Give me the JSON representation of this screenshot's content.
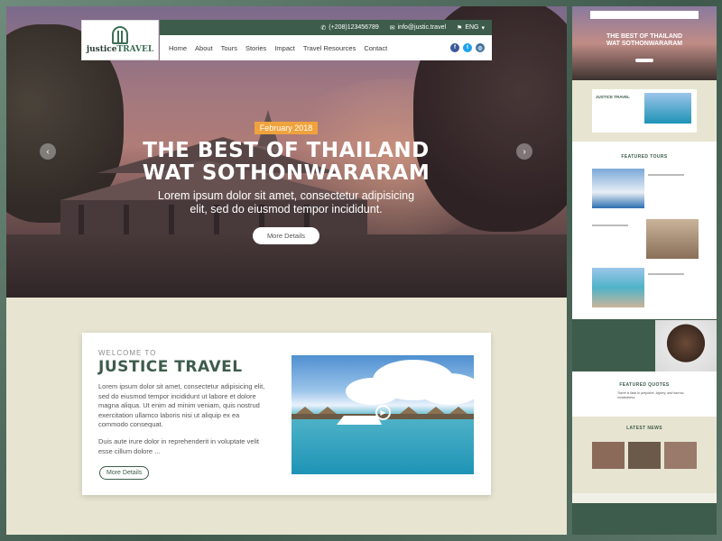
{
  "topbar": {
    "phone": "(+208)123456789",
    "email": "info@justic.travel",
    "language": "ENG"
  },
  "logo": {
    "word1": "justice",
    "word2": "TRAVEL"
  },
  "nav": {
    "items": [
      "Home",
      "About",
      "Tours",
      "Stories",
      "Impact",
      "Travel Resources",
      "Contact"
    ]
  },
  "socials": [
    {
      "icon": "facebook-icon",
      "glyph": "f",
      "color": "#3b5998"
    },
    {
      "icon": "twitter-icon",
      "glyph": "t",
      "color": "#1da1f2"
    },
    {
      "icon": "instagram-icon",
      "glyph": "◎",
      "color": "#3f729b"
    }
  ],
  "hero": {
    "date": "February 2018",
    "title_line1": "THE BEST OF THAILAND",
    "title_line2": "WAT SOTHONWARARAM",
    "subtitle_line1": "Lorem ipsum dolor sit amet, consectetur adipisicing",
    "subtitle_line2": "elit, sed do eiusmod tempor incididunt.",
    "button": "More Details"
  },
  "welcome": {
    "small": "WELCOME TO",
    "title": "JUSTICE TRAVEL",
    "p1": "Lorem ipsum dolor sit amet, consectetur adipisicing elit, sed do eiusmod tempor incididunt ut labore et dolore magna aliqua. Ut enim ad minim veniam, quis nostrud exercitation ullamco laboris nisi ut aliquip ex ea commodo consequat.",
    "p2": "Duis aute irure dolor in reprehenderit in voluptate velit esse cillum dolore ...",
    "button": "More Details"
  },
  "preview": {
    "hero_title_line1": "THE BEST OF THAILAND",
    "hero_title_line2": "WAT SOTHONWARARAM",
    "welcome_title": "JUSTICE TRAVEL",
    "featured_tours": "FEATURED TOURS",
    "featured_quotes": "FEATURED QUOTES",
    "quote": "Travel is fatal to prejudice, bigotry, and narrow-mindedness",
    "latest_news": "LATEST NEWS"
  },
  "colors": {
    "brand_green": "#3d5c4b",
    "accent_orange": "#f0a33d",
    "beige": "#e7e5d1"
  }
}
